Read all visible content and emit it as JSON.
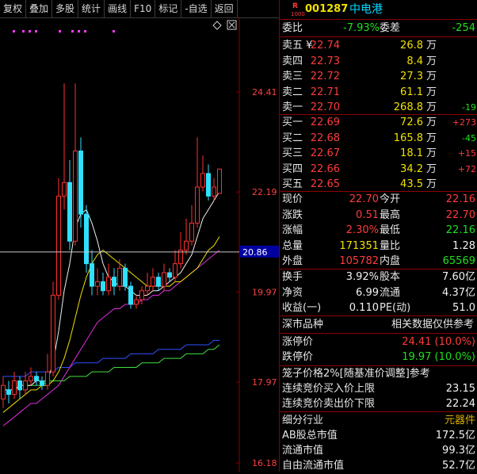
{
  "toolbar": [
    "复权",
    "叠加",
    "多股",
    "统计",
    "画线",
    "F10",
    "标记",
    "-自选",
    "返回"
  ],
  "header": {
    "badge_r": "R",
    "badge_code": "1000",
    "code": "001287",
    "name": "中电港"
  },
  "weibi": {
    "label1": "委比",
    "pct": "-7.93%",
    "label2": "委差",
    "diff": "-254"
  },
  "sells": [
    {
      "label": "卖五 ¥",
      "price": "22.74",
      "vol": "26.8",
      "unit": "万",
      "chg": ""
    },
    {
      "label": "卖四",
      "price": "22.73",
      "vol": "8.4",
      "unit": "万",
      "chg": ""
    },
    {
      "label": "卖三",
      "price": "22.72",
      "vol": "27.3",
      "unit": "万",
      "chg": ""
    },
    {
      "label": "卖二",
      "price": "22.71",
      "vol": "61.1",
      "unit": "万",
      "chg": ""
    },
    {
      "label": "卖一",
      "price": "22.70",
      "vol": "268.8",
      "unit": "万",
      "chg": "-19"
    }
  ],
  "buys": [
    {
      "label": "买一",
      "price": "22.69",
      "vol": "72.6",
      "unit": "万",
      "chg": "+273"
    },
    {
      "label": "买二",
      "price": "22.68",
      "vol": "165.8",
      "unit": "万",
      "chg": "-45"
    },
    {
      "label": "买三",
      "price": "22.67",
      "vol": "18.1",
      "unit": "万",
      "chg": "+15"
    },
    {
      "label": "买四",
      "price": "22.66",
      "vol": "34.2",
      "unit": "万",
      "chg": "+72"
    },
    {
      "label": "买五",
      "price": "22.65",
      "vol": "43.5",
      "unit": "万",
      "chg": ""
    }
  ],
  "stats": [
    {
      "l1": "现价",
      "v1": "22.70",
      "l2": "今开",
      "v2": "22.16"
    },
    {
      "l1": "涨跌",
      "v1": "0.51",
      "l2": "最高",
      "v2": "22.70"
    },
    {
      "l1": "涨幅",
      "v1": "2.30%",
      "l2": "最低",
      "v2": "22.16"
    },
    {
      "l1": "总量",
      "v1": "171351",
      "l2": "量比",
      "v2": "1.28"
    },
    {
      "l1": "外盘",
      "v1": "105782",
      "l2": "内盘",
      "v2": "65569"
    }
  ],
  "stats2": [
    {
      "l1": "换手",
      "v1": "3.92%",
      "l2": "股本",
      "v2": "7.60亿"
    },
    {
      "l1": "净资",
      "v1": "6.99",
      "l2": "流通",
      "v2": "4.37亿"
    },
    {
      "l1": "收益(一)",
      "v1": "0.110",
      "l2": "PE(动)",
      "v2": "51.0"
    }
  ],
  "market": {
    "name": "深市品种",
    "note": "相关数据仅供参考"
  },
  "limits": [
    {
      "label": "涨停价",
      "value": "24.41 (10.0%)"
    },
    {
      "label": "跌停价",
      "value": "19.97 (10.0%)"
    }
  ],
  "cage": {
    "title": "笼子价格2%[随基准价调整]参考",
    "buy_label": "连续竞价买入价上限",
    "buy_value": "23.15",
    "sell_label": "连续竞价卖出价下限",
    "sell_value": "22.24"
  },
  "industry": [
    {
      "label": "细分行业",
      "value": "元器件"
    },
    {
      "label": "AB股总市值",
      "value": "172.5亿"
    },
    {
      "label": "流通市值",
      "value": "99.3亿"
    },
    {
      "label": "自由流通市值",
      "value": "52.7亿"
    }
  ],
  "chart_data": {
    "type": "candlestick",
    "y_ticks": [
      "24.41",
      "22.19",
      "19.97",
      "17.97",
      "16.18"
    ],
    "current_price_label": "20.86",
    "candles": [
      {
        "o": 17.6,
        "c": 17.9,
        "h": 18.1,
        "l": 17.4
      },
      {
        "o": 17.8,
        "c": 17.7,
        "h": 18.0,
        "l": 17.5
      },
      {
        "o": 17.7,
        "c": 18.0,
        "h": 18.2,
        "l": 17.6
      },
      {
        "o": 18.0,
        "c": 17.8,
        "h": 18.1,
        "l": 17.6
      },
      {
        "o": 17.8,
        "c": 18.0,
        "h": 18.2,
        "l": 17.7
      },
      {
        "o": 18.0,
        "c": 18.1,
        "h": 18.3,
        "l": 17.9
      },
      {
        "o": 18.1,
        "c": 18.0,
        "h": 18.2,
        "l": 17.9
      },
      {
        "o": 18.0,
        "c": 17.9,
        "h": 18.1,
        "l": 17.8
      },
      {
        "o": 17.9,
        "c": 18.2,
        "h": 18.6,
        "l": 17.8
      },
      {
        "o": 18.2,
        "c": 19.9,
        "h": 20.2,
        "l": 18.1
      },
      {
        "o": 19.9,
        "c": 22.1,
        "h": 22.5,
        "l": 19.8
      },
      {
        "o": 22.1,
        "c": 22.4,
        "h": 24.6,
        "l": 21.8
      },
      {
        "o": 22.4,
        "c": 21.1,
        "h": 22.9,
        "l": 20.9
      },
      {
        "o": 21.1,
        "c": 23.1,
        "h": 24.6,
        "l": 21.0
      },
      {
        "o": 23.1,
        "c": 21.7,
        "h": 23.4,
        "l": 21.4
      },
      {
        "o": 21.7,
        "c": 20.6,
        "h": 21.9,
        "l": 20.4
      },
      {
        "o": 20.6,
        "c": 20.1,
        "h": 20.9,
        "l": 19.9
      },
      {
        "o": 20.1,
        "c": 20.2,
        "h": 20.5,
        "l": 19.9
      },
      {
        "o": 20.2,
        "c": 20.0,
        "h": 20.4,
        "l": 19.9
      },
      {
        "o": 20.0,
        "c": 20.3,
        "h": 20.6,
        "l": 19.9
      },
      {
        "o": 20.3,
        "c": 20.1,
        "h": 20.5,
        "l": 19.9
      },
      {
        "o": 20.1,
        "c": 20.5,
        "h": 20.7,
        "l": 20.0
      },
      {
        "o": 20.5,
        "c": 20.1,
        "h": 20.6,
        "l": 20.0
      },
      {
        "o": 20.1,
        "c": 19.7,
        "h": 20.2,
        "l": 19.6
      },
      {
        "o": 19.7,
        "c": 19.8,
        "h": 19.9,
        "l": 19.6
      },
      {
        "o": 19.8,
        "c": 20.0,
        "h": 20.1,
        "l": 19.7
      },
      {
        "o": 20.0,
        "c": 20.1,
        "h": 20.4,
        "l": 19.9
      },
      {
        "o": 20.1,
        "c": 20.3,
        "h": 20.5,
        "l": 20.0
      },
      {
        "o": 20.3,
        "c": 20.1,
        "h": 20.4,
        "l": 20.0
      },
      {
        "o": 20.1,
        "c": 20.4,
        "h": 20.6,
        "l": 20.0
      },
      {
        "o": 20.4,
        "c": 20.3,
        "h": 20.5,
        "l": 20.2
      },
      {
        "o": 20.3,
        "c": 20.6,
        "h": 20.9,
        "l": 20.2
      },
      {
        "o": 20.6,
        "c": 20.9,
        "h": 21.3,
        "l": 20.5
      },
      {
        "o": 20.9,
        "c": 21.1,
        "h": 21.6,
        "l": 20.8
      },
      {
        "o": 21.1,
        "c": 21.5,
        "h": 21.9,
        "l": 21.0
      },
      {
        "o": 21.5,
        "c": 22.3,
        "h": 23.4,
        "l": 21.4
      },
      {
        "o": 22.3,
        "c": 22.6,
        "h": 23.0,
        "l": 22.2
      },
      {
        "o": 22.6,
        "c": 22.1,
        "h": 22.8,
        "l": 22.0
      },
      {
        "o": 22.1,
        "c": 22.3,
        "h": 22.5,
        "l": 22.0
      },
      {
        "o": 22.16,
        "c": 22.7,
        "h": 22.7,
        "l": 22.16
      }
    ],
    "ma_white": [
      17.8,
      17.8,
      17.8,
      17.9,
      17.9,
      17.9,
      18.0,
      18.0,
      18.0,
      18.4,
      19.1,
      20.0,
      20.6,
      21.4,
      21.7,
      21.8,
      21.5,
      21.1,
      20.6,
      20.3,
      20.2,
      20.1,
      20.1,
      20.0,
      19.9,
      19.9,
      19.9,
      20.0,
      20.0,
      20.1,
      20.2,
      20.3,
      20.4,
      20.6,
      20.8,
      21.2,
      21.6,
      21.8,
      22.0,
      22.2
    ],
    "ma_yellow": [
      17.3,
      17.4,
      17.5,
      17.6,
      17.7,
      17.8,
      17.8,
      17.9,
      17.9,
      18.0,
      18.2,
      18.5,
      18.9,
      19.4,
      19.9,
      20.3,
      20.6,
      20.8,
      20.9,
      20.8,
      20.7,
      20.6,
      20.5,
      20.4,
      20.3,
      20.2,
      20.1,
      20.1,
      20.1,
      20.1,
      20.1,
      20.2,
      20.2,
      20.3,
      20.4,
      20.5,
      20.7,
      20.9,
      21.0,
      21.2
    ],
    "ma_magenta": [
      17.0,
      17.1,
      17.2,
      17.3,
      17.4,
      17.5,
      17.5,
      17.6,
      17.7,
      17.8,
      17.9,
      18.1,
      18.3,
      18.5,
      18.7,
      18.9,
      19.1,
      19.3,
      19.4,
      19.5,
      19.6,
      19.6,
      19.7,
      19.7,
      19.7,
      19.8,
      19.8,
      19.9,
      19.9,
      20.0,
      20.0,
      20.1,
      20.2,
      20.3,
      20.4,
      20.5,
      20.6,
      20.7,
      20.8,
      20.9
    ],
    "ma_blue": [
      18.1,
      18.1,
      18.1,
      18.1,
      18.1,
      18.2,
      18.2,
      18.2,
      18.2,
      18.2,
      18.3,
      18.3,
      18.3,
      18.4,
      18.4,
      18.4,
      18.4,
      18.4,
      18.5,
      18.5,
      18.5,
      18.5,
      18.5,
      18.6,
      18.6,
      18.6,
      18.6,
      18.6,
      18.7,
      18.7,
      18.7,
      18.7,
      18.7,
      18.8,
      18.8,
      18.8,
      18.8,
      18.8,
      18.9,
      18.9
    ],
    "ma_green": [
      17.8,
      17.8,
      17.8,
      17.9,
      17.9,
      17.9,
      17.9,
      17.9,
      18.0,
      18.0,
      18.0,
      18.0,
      18.1,
      18.1,
      18.1,
      18.1,
      18.2,
      18.2,
      18.2,
      18.2,
      18.3,
      18.3,
      18.3,
      18.3,
      18.3,
      18.4,
      18.4,
      18.4,
      18.4,
      18.5,
      18.5,
      18.5,
      18.5,
      18.6,
      18.6,
      18.6,
      18.6,
      18.7,
      18.7,
      18.8
    ]
  }
}
